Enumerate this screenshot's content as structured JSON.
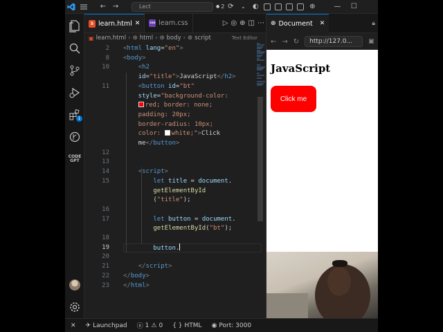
{
  "titlebar": {
    "search_placeholder": "Lect",
    "badge_count": "2"
  },
  "editor": {
    "tabs": [
      {
        "label": "learn.html",
        "badge": "5"
      },
      {
        "label": "learn.css",
        "badge": "css"
      }
    ],
    "breadcrumb": [
      "learn.html",
      "html",
      "body",
      "script"
    ],
    "breadcrumb_extra": "Text Editor",
    "lines": [
      {
        "n": "2",
        "parts": [
          [
            "t",
            "<"
          ],
          [
            "tn",
            "html"
          ],
          [
            "at",
            " lang"
          ],
          [
            "pl",
            "="
          ],
          [
            "st",
            "\"en\""
          ],
          [
            "t",
            ">"
          ]
        ]
      },
      {
        "n": "8",
        "parts": [
          [
            "t",
            "<"
          ],
          [
            "tn",
            "body"
          ],
          [
            "t",
            ">"
          ]
        ]
      },
      {
        "n": "10",
        "parts": [
          [
            "pl",
            "    "
          ],
          [
            "t",
            "<"
          ],
          [
            "tn",
            "h2"
          ]
        ]
      },
      {
        "n": "",
        "parts": [
          [
            "at",
            "    id"
          ],
          [
            "pl",
            "="
          ],
          [
            "st",
            "\"title\""
          ],
          [
            "t",
            ">"
          ],
          [
            "pl",
            "JavaScript"
          ],
          [
            "t",
            "</"
          ],
          [
            "tn",
            "h2"
          ],
          [
            "t",
            ">"
          ]
        ]
      },
      {
        "n": "11",
        "parts": [
          [
            "pl",
            "    "
          ],
          [
            "t",
            "<"
          ],
          [
            "tn",
            "button"
          ],
          [
            "at",
            " id"
          ],
          [
            "pl",
            "="
          ],
          [
            "st",
            "\"bt\""
          ]
        ]
      },
      {
        "n": "",
        "parts": [
          [
            "at",
            "    style"
          ],
          [
            "pl",
            "="
          ],
          [
            "st",
            "\"background-color:"
          ]
        ]
      },
      {
        "n": "",
        "swatch": "#ff0000",
        "parts": [
          [
            "st",
            "red; border: none;"
          ]
        ]
      },
      {
        "n": "",
        "parts": [
          [
            "st",
            "    padding: 20px;"
          ]
        ]
      },
      {
        "n": "",
        "parts": [
          [
            "st",
            "    border-radius: 10px;"
          ]
        ]
      },
      {
        "n": "",
        "swatch2": "#ffffff",
        "parts": [
          [
            "st",
            "    color: "
          ],
          [
            "st",
            "white;\""
          ],
          [
            "t",
            ">"
          ],
          [
            "pl",
            "Click"
          ]
        ]
      },
      {
        "n": "",
        "parts": [
          [
            "pl",
            "    me"
          ],
          [
            "t",
            "</"
          ],
          [
            "tn",
            "button"
          ],
          [
            "t",
            ">"
          ]
        ]
      },
      {
        "n": "12",
        "parts": []
      },
      {
        "n": "13",
        "parts": []
      },
      {
        "n": "14",
        "parts": [
          [
            "pl",
            "    "
          ],
          [
            "t",
            "<"
          ],
          [
            "tn",
            "script"
          ],
          [
            "t",
            ">"
          ]
        ]
      },
      {
        "n": "15",
        "parts": [
          [
            "kw",
            "        let"
          ],
          [
            "va",
            " title"
          ],
          [
            "pl",
            " = "
          ],
          [
            "va",
            "document"
          ],
          [
            "pl",
            "."
          ]
        ]
      },
      {
        "n": "",
        "parts": [
          [
            "fn",
            "        getElementById"
          ]
        ]
      },
      {
        "n": "",
        "parts": [
          [
            "pl",
            "        ("
          ],
          [
            "st",
            "\"title\""
          ],
          [
            "pl",
            ");"
          ]
        ]
      },
      {
        "n": "16",
        "parts": []
      },
      {
        "n": "17",
        "parts": [
          [
            "kw",
            "        let"
          ],
          [
            "va",
            " button"
          ],
          [
            "pl",
            " = "
          ],
          [
            "va",
            "document"
          ],
          [
            "pl",
            "."
          ]
        ]
      },
      {
        "n": "",
        "parts": [
          [
            "fn",
            "        getElementById"
          ],
          [
            "pl",
            "("
          ],
          [
            "st",
            "\"bt\""
          ],
          [
            "pl",
            ");"
          ]
        ]
      },
      {
        "n": "18",
        "parts": []
      },
      {
        "n": "19",
        "current": true,
        "parts": [
          [
            "va",
            "        button"
          ],
          [
            "pl",
            "."
          ]
        ]
      },
      {
        "n": "20",
        "parts": []
      },
      {
        "n": "21",
        "parts": [
          [
            "pl",
            "    "
          ],
          [
            "t",
            "</"
          ],
          [
            "tn",
            "script"
          ],
          [
            "t",
            ">"
          ]
        ]
      },
      {
        "n": "22",
        "parts": [
          [
            "t",
            "</"
          ],
          [
            "tn",
            "body"
          ],
          [
            "t",
            ">"
          ]
        ]
      },
      {
        "n": "23",
        "parts": [
          [
            "t",
            "</"
          ],
          [
            "tn",
            "html"
          ],
          [
            "t",
            ">"
          ]
        ]
      }
    ]
  },
  "browser": {
    "tab_label": "Document",
    "url": "http://127.0...",
    "page_heading": "JavaScript",
    "page_button": "Click me"
  },
  "activity": {
    "extensions_badge": "1"
  },
  "statusbar": {
    "launchpad": "Launchpad",
    "errors": "1",
    "warnings": "0",
    "language": "HTML",
    "port": "Port: 3000"
  }
}
